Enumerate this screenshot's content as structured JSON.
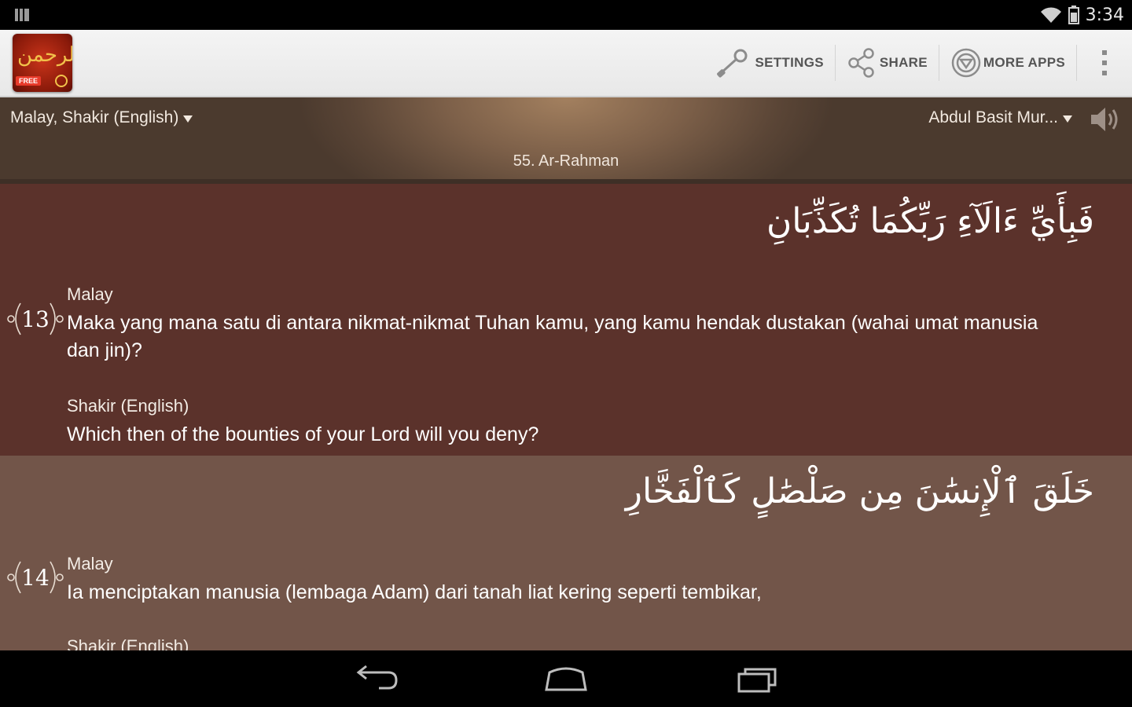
{
  "status_bar": {
    "time": "3:34",
    "icons": [
      "notification-icon",
      "wifi-icon",
      "battery-icon"
    ]
  },
  "action_bar": {
    "logo": {
      "calligraphy": "الرحمن",
      "badge": "FREE"
    },
    "settings_label": "SETTINGS",
    "share_label": "SHARE",
    "more_apps_label": "MORE APPS"
  },
  "header": {
    "translation_selector": "Malay, Shakir (English)",
    "reciter_selector": "Abdul Basit Mur...",
    "surah_title": "55. Ar-Rahman"
  },
  "verses": [
    {
      "number": "13",
      "arabic": "فَبِأَيِّ ءَالَآءِ رَبِّكُمَا تُكَذِّبَانِ",
      "translations": [
        {
          "name": "Malay",
          "text": "Maka yang mana satu di antara nikmat-nikmat Tuhan kamu, yang kamu hendak dustakan (wahai umat manusia dan jin)?"
        },
        {
          "name": "Shakir (English)",
          "text": "Which then of the bounties of your Lord will you deny?"
        }
      ]
    },
    {
      "number": "14",
      "arabic": "خَلَقَ ٱلْإِنسَٰنَ مِن صَلْصَٰلٍ كَٱلْفَخَّارِ",
      "translations": [
        {
          "name": "Malay",
          "text": "Ia menciptakan manusia (lembaga Adam) dari tanah liat kering seperti tembikar,"
        },
        {
          "name": "Shakir (English)",
          "text": ""
        }
      ]
    }
  ],
  "colors": {
    "verse_dark_bg": "#5b322b",
    "verse_light_bg": "#725549",
    "action_bar_bg": "#eeeeee"
  }
}
